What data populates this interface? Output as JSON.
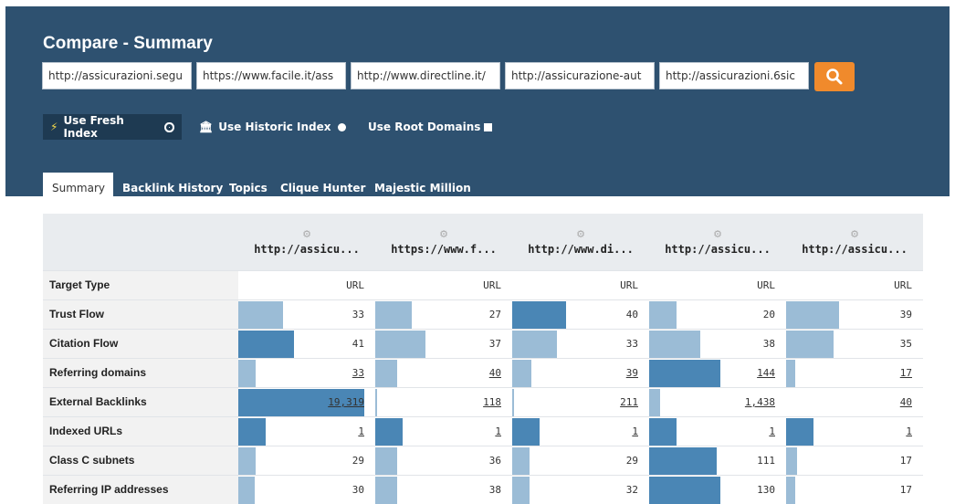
{
  "title": "Compare - Summary",
  "urls": [
    "http://assicurazioni.segu",
    "https://www.facile.it/ass",
    "http://www.directline.it/",
    "http://assicurazione-aut",
    "http://assicurazioni.6sic"
  ],
  "options": {
    "fresh": "Use Fresh Index",
    "historic": "Use Historic Index",
    "root": "Use Root Domains"
  },
  "tabs": [
    "Summary",
    "Backlink History",
    "Topics",
    "Clique Hunter",
    "Majestic Million"
  ],
  "columns": [
    "http://assicu...",
    "https://www.f...",
    "http://www.di...",
    "http://assicu...",
    "http://assicu..."
  ],
  "colors": {
    "header_bg": "#2e5170",
    "accent": "#f08a2c",
    "bar_dark": "#4a86b5",
    "bar_light": "#9bbcd6"
  },
  "rows": [
    {
      "label": "Target Type",
      "values": [
        "URL",
        "URL",
        "URL",
        "URL",
        "URL"
      ],
      "link": false,
      "bars": [
        0,
        0,
        0,
        0,
        0
      ],
      "tone": [
        "light",
        "light",
        "light",
        "light",
        "light"
      ]
    },
    {
      "label": "Trust Flow",
      "values": [
        "33",
        "27",
        "40",
        "20",
        "39"
      ],
      "link": false,
      "bars": [
        0.33,
        0.27,
        0.4,
        0.2,
        0.39
      ],
      "tone": [
        "light",
        "light",
        "dark",
        "light",
        "light"
      ]
    },
    {
      "label": "Citation Flow",
      "values": [
        "41",
        "37",
        "33",
        "38",
        "35"
      ],
      "link": false,
      "bars": [
        0.41,
        0.37,
        0.33,
        0.38,
        0.35
      ],
      "tone": [
        "dark",
        "light",
        "light",
        "light",
        "light"
      ]
    },
    {
      "label": "Referring domains",
      "values": [
        "33",
        "40",
        "39",
        "144",
        "17"
      ],
      "link": true,
      "bars": [
        0.13,
        0.16,
        0.14,
        0.53,
        0.07
      ],
      "tone": [
        "light",
        "light",
        "light",
        "dark",
        "light"
      ]
    },
    {
      "label": "External Backlinks",
      "values": [
        "19,319",
        "118",
        "211",
        "1,438",
        "40"
      ],
      "link": true,
      "bars": [
        0.93,
        0.01,
        0.01,
        0.08,
        0.0
      ],
      "tone": [
        "dark",
        "light",
        "light",
        "light",
        "light"
      ]
    },
    {
      "label": "Indexed URLs",
      "values": [
        "1",
        "1",
        "1",
        "1",
        "1"
      ],
      "link": true,
      "bars": [
        0.2,
        0.2,
        0.2,
        0.2,
        0.2
      ],
      "tone": [
        "dark",
        "dark",
        "dark",
        "dark",
        "dark"
      ]
    },
    {
      "label": "Class C subnets",
      "values": [
        "29",
        "36",
        "29",
        "111",
        "17"
      ],
      "link": false,
      "bars": [
        0.13,
        0.16,
        0.13,
        0.5,
        0.08
      ],
      "tone": [
        "light",
        "light",
        "light",
        "dark",
        "light"
      ]
    },
    {
      "label": "Referring IP addresses",
      "values": [
        "30",
        "38",
        "32",
        "130",
        "17"
      ],
      "link": false,
      "bars": [
        0.12,
        0.16,
        0.13,
        0.53,
        0.07
      ],
      "tone": [
        "light",
        "light",
        "light",
        "dark",
        "light"
      ]
    }
  ]
}
